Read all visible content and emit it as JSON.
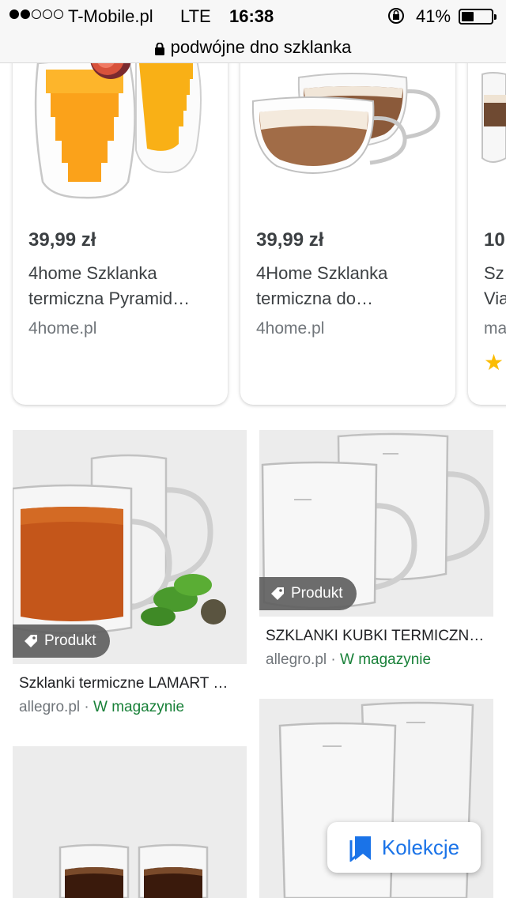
{
  "status_bar": {
    "carrier": "T-Mobile.pl",
    "network": "LTE",
    "time": "16:38",
    "battery_percent": "41%",
    "battery_level": 0.41,
    "signal_bars_filled": 2,
    "signal_bars_total": 5
  },
  "url_bar": {
    "query": "podwójne dno szklanka"
  },
  "carousel": {
    "cards": [
      {
        "price": "39,99 zł",
        "title_line1": "4home Szklanka",
        "title_line2": "termiczna Pyramid…",
        "source": "4home.pl"
      },
      {
        "price": "39,99 zł",
        "title_line1": "4Home Szklanka",
        "title_line2": "termiczna do…",
        "source": "4home.pl"
      },
      {
        "price": "10",
        "title_line1": "Sz",
        "title_line2": "Via",
        "source": "ma",
        "rating_icon": "star-icon"
      }
    ]
  },
  "grid": {
    "badge_label": "Produkt",
    "tiles": [
      {
        "title": "Szklanki termiczne LAMART …",
        "source": "allegro.pl",
        "separator": " · ",
        "stock": "W magazynie"
      },
      {
        "title": "SZKLANKI KUBKI TERMICZN…",
        "source": "allegro.pl",
        "separator": " · ",
        "stock": "W magazynie"
      },
      {
        "title": "",
        "source": "",
        "stock": ""
      },
      {
        "title": "",
        "source": "",
        "stock": ""
      }
    ]
  },
  "fab": {
    "label": "Kolekcje",
    "icon": "bookmark-icon"
  },
  "colors": {
    "accent": "#1a73e8",
    "stock_green": "#188038",
    "star": "#fbbc04",
    "badge": "#5f5f5f"
  }
}
